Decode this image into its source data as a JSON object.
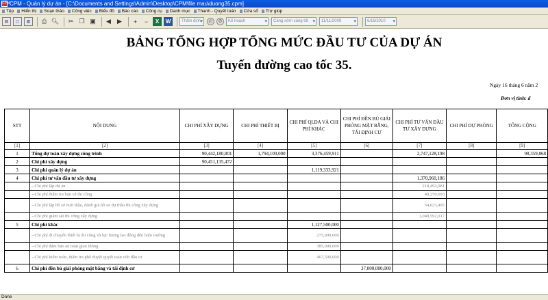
{
  "window": {
    "title": "CPM - Quản lý dự án - [C:\\Documents and Settings\\Admin\\Desktop\\CPM\\file mau\\duong35.cpm]",
    "icon_text": "CPM"
  },
  "menu": [
    "Tệp",
    "Hiển thị",
    "Soạn thảo",
    "Công việc",
    "Biểu đồ",
    "Báo cáo",
    "Công cụ",
    "Danh mục",
    "Thanh - Quyết toán",
    "Cửa sổ",
    "Trợ giúp"
  ],
  "toolbar": {
    "view_combo": "Thẩm định",
    "plan_combo": "Kế hoạch",
    "schedule_combo": "Càng sớm càng tốt",
    "date_combo": "11/11/2009",
    "date_combo2": "6/16/2010"
  },
  "document": {
    "title": "BẢNG TỔNG HỢP TỔNG MỨC ĐẦU TƯ CỦA DỰ ÁN",
    "subtitle": "Tuyến đường cao tốc 35.",
    "date_line": "Ngày 16 tháng 6 năm 2",
    "unit_line": "Đơn vị tính: đ"
  },
  "table": {
    "headers": [
      "STT",
      "NỘI DUNG",
      "CHI PHÍ XÂY DỰNG",
      "CHI PHÍ THIẾT BỊ",
      "CHI PHÍ QLDA VÀ CHI PHÍ KHÁC",
      "CHI PHÍ ĐỀN BÙ GIẢI PHÓNG MẶT BẰNG, TÁI ĐỊNH CƯ",
      "CHI PHÍ TƯ VẤN ĐẦU TƯ XÂY DỰNG",
      "CHI PHÍ DỰ PHÒNG",
      "TỔNG CỘNG"
    ],
    "index_row": [
      "[1]",
      "[2]",
      "[3]",
      "[4]",
      "[5]",
      "[6]",
      "[7]",
      "[8]",
      "[9]"
    ],
    "rows": [
      {
        "stt": "1",
        "content": "Tổng dự toán xây dựng công trình",
        "c3": "90,442,180,801",
        "c4": "1,794,100,000",
        "c5": "3,376,459,911",
        "c6": "",
        "c7": "2,747,128,198",
        "c8": "",
        "c9": "98,359,868",
        "bold": true
      },
      {
        "stt": "2",
        "content": "Chi phí xây dựng",
        "c3": "90,451,135,472",
        "c4": "",
        "c5": "",
        "c6": "",
        "c7": "",
        "c8": "",
        "c9": "",
        "bold": true
      },
      {
        "stt": "3",
        "content": "Chi phí quản lý dự án",
        "c3": "",
        "c4": "",
        "c5": "1,119,333,921",
        "c6": "",
        "c7": "",
        "c8": "",
        "c9": "",
        "bold": true
      },
      {
        "stt": "4",
        "content": "Chi phí tư vấn đầu tư xây dựng",
        "c3": "",
        "c4": "",
        "c5": "",
        "c6": "",
        "c7": "1,370,960,186",
        "c8": "",
        "c9": "",
        "bold": true
      },
      {
        "stt": "",
        "content": "--Chi phí lập dự án",
        "c3": "",
        "c4": "",
        "c5": "",
        "c6": "",
        "c7": "218,493,981",
        "c8": "",
        "c9": "",
        "sub": true
      },
      {
        "stt": "",
        "content": "--Chi phí thẩm tra bản vẽ thi công",
        "c3": "",
        "c4": "",
        "c5": "",
        "c6": "",
        "c7": "49,250,693",
        "c8": "",
        "c9": "",
        "sub": true
      },
      {
        "stt": "",
        "content": "--Chi phí lập hồ sơ mời thầu, đánh giá hồ sơ dự thầu thi công xây dựng",
        "c3": "",
        "c4": "",
        "c5": "",
        "c6": "",
        "c7": "54,623,495",
        "c8": "",
        "c9": "",
        "sub": true,
        "tall": true
      },
      {
        "stt": "",
        "content": "--Chi phí giám sát thi công xây dựng",
        "c3": "",
        "c4": "",
        "c5": "",
        "c6": "",
        "c7": "1,048,592,017",
        "c8": "",
        "c9": "",
        "sub": true
      },
      {
        "stt": "5",
        "content": "Chi phí khác",
        "c3": "",
        "c4": "",
        "c5": "1,127,500,000",
        "c6": "",
        "c7": "",
        "c8": "",
        "c9": "",
        "bold": true
      },
      {
        "stt": "",
        "content": "--Chi phí di chuyển thiết bị thi công và lực lượng lao động đến hiện trường",
        "c3": "",
        "c4": "",
        "c5": "275,000,000",
        "c6": "",
        "c7": "",
        "c8": "",
        "c9": "",
        "sub": true,
        "tall": true
      },
      {
        "stt": "",
        "content": "--Chi phí đảm bảo an toàn giao thông",
        "c3": "",
        "c4": "",
        "c5": "385,000,000",
        "c6": "",
        "c7": "",
        "c8": "",
        "c9": "",
        "sub": true
      },
      {
        "stt": "",
        "content": "--Chi phí kiểm toán, thẩm tra phê duyệt quyết toán vốn đầu tư",
        "c3": "",
        "c4": "",
        "c5": "467,500,000",
        "c6": "",
        "c7": "",
        "c8": "",
        "c9": "",
        "sub": true,
        "tall": true
      },
      {
        "stt": "6",
        "content": "Chi phí đền bù giải phóng mặt bằng và tái định cư",
        "c3": "",
        "c4": "",
        "c5": "",
        "c6": "37,000,000,000",
        "c7": "",
        "c8": "",
        "c9": "",
        "bold": true
      }
    ]
  },
  "status": {
    "text": "Done"
  }
}
